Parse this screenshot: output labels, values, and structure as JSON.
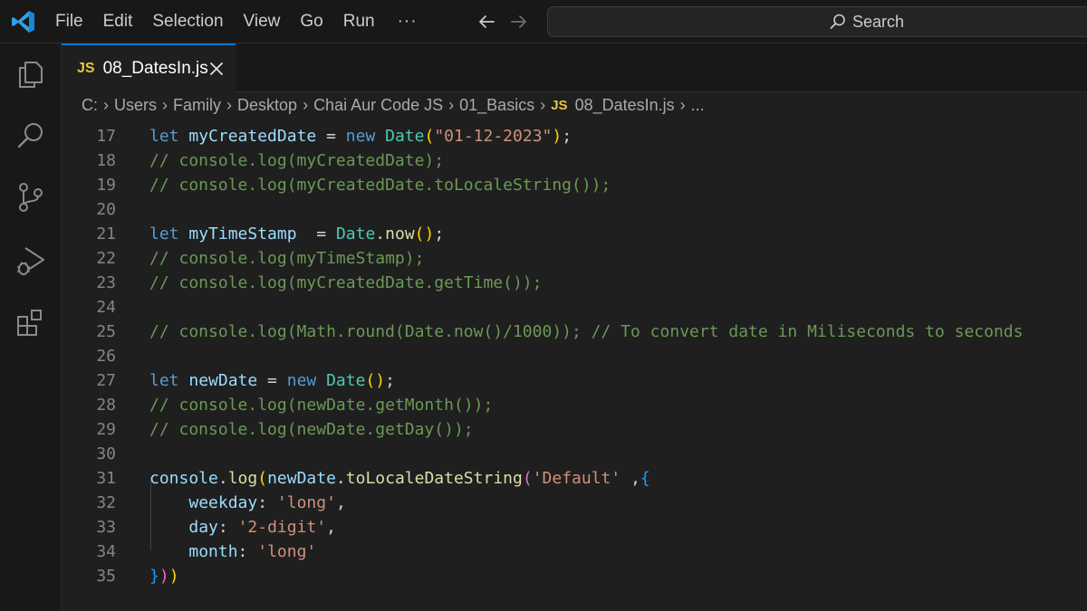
{
  "menu": {
    "items": [
      "File",
      "Edit",
      "Selection",
      "View",
      "Go",
      "Run"
    ],
    "more": "···"
  },
  "search": {
    "label": "Search"
  },
  "tab": {
    "badge": "JS",
    "label": "08_DatesIn.js"
  },
  "breadcrumb": {
    "parts": [
      "C:",
      "Users",
      "Family",
      "Desktop",
      "Chai Aur Code JS",
      "01_Basics"
    ],
    "file_badge": "JS",
    "file": "08_DatesIn.js",
    "more": "..."
  },
  "editor": {
    "lines": [
      {
        "n": "17",
        "tokens": [
          [
            "kw",
            "let "
          ],
          [
            "var",
            "myCreatedDate"
          ],
          [
            "pun",
            " = "
          ],
          [
            "kw",
            "new "
          ],
          [
            "cls",
            "Date"
          ],
          [
            "br1",
            "("
          ],
          [
            "str",
            "\"01-12-2023\""
          ],
          [
            "br1",
            ")"
          ],
          [
            "pun",
            ";"
          ]
        ]
      },
      {
        "n": "18",
        "tokens": [
          [
            "cmt",
            "// console.log(myCreatedDate);"
          ]
        ]
      },
      {
        "n": "19",
        "tokens": [
          [
            "cmt",
            "// console.log(myCreatedDate.toLocaleString());"
          ]
        ]
      },
      {
        "n": "20",
        "tokens": []
      },
      {
        "n": "21",
        "tokens": [
          [
            "kw",
            "let "
          ],
          [
            "var",
            "myTimeStamp"
          ],
          [
            "pun",
            "  = "
          ],
          [
            "cls",
            "Date"
          ],
          [
            "pun",
            "."
          ],
          [
            "fn",
            "now"
          ],
          [
            "br1",
            "()"
          ],
          [
            "pun",
            ";"
          ]
        ]
      },
      {
        "n": "22",
        "tokens": [
          [
            "cmt",
            "// console.log(myTimeStamp);"
          ]
        ]
      },
      {
        "n": "23",
        "tokens": [
          [
            "cmt",
            "// console.log(myCreatedDate.getTime());"
          ]
        ]
      },
      {
        "n": "24",
        "tokens": []
      },
      {
        "n": "25",
        "tokens": [
          [
            "cmt",
            "// console.log(Math.round(Date.now()/1000)); // To convert date in Miliseconds to seconds"
          ]
        ]
      },
      {
        "n": "26",
        "tokens": []
      },
      {
        "n": "27",
        "tokens": [
          [
            "kw",
            "let "
          ],
          [
            "var",
            "newDate"
          ],
          [
            "pun",
            " = "
          ],
          [
            "kw",
            "new "
          ],
          [
            "cls",
            "Date"
          ],
          [
            "br1",
            "()"
          ],
          [
            "pun",
            ";"
          ]
        ]
      },
      {
        "n": "28",
        "tokens": [
          [
            "cmt",
            "// console.log(newDate.getMonth());"
          ]
        ]
      },
      {
        "n": "29",
        "tokens": [
          [
            "cmt",
            "// console.log(newDate.getDay());"
          ]
        ]
      },
      {
        "n": "30",
        "tokens": []
      },
      {
        "n": "31",
        "tokens": [
          [
            "var",
            "console"
          ],
          [
            "pun",
            "."
          ],
          [
            "fn",
            "log"
          ],
          [
            "br1",
            "("
          ],
          [
            "var",
            "newDate"
          ],
          [
            "pun",
            "."
          ],
          [
            "fn",
            "toLocaleDateString"
          ],
          [
            "br2",
            "("
          ],
          [
            "str",
            "'Default'"
          ],
          [
            "pun",
            " ,"
          ],
          [
            "br3",
            "{"
          ]
        ]
      },
      {
        "n": "32",
        "tokens": [
          [
            "pun",
            "    "
          ],
          [
            "var",
            "weekday"
          ],
          [
            "pun",
            ": "
          ],
          [
            "str",
            "'long'"
          ],
          [
            "pun",
            ","
          ]
        ]
      },
      {
        "n": "33",
        "tokens": [
          [
            "pun",
            "    "
          ],
          [
            "var",
            "day"
          ],
          [
            "pun",
            ": "
          ],
          [
            "str",
            "'2-digit'"
          ],
          [
            "pun",
            ","
          ]
        ]
      },
      {
        "n": "34",
        "tokens": [
          [
            "pun",
            "    "
          ],
          [
            "var",
            "month"
          ],
          [
            "pun",
            ": "
          ],
          [
            "str",
            "'long'"
          ]
        ]
      },
      {
        "n": "35",
        "tokens": [
          [
            "br3",
            "}"
          ],
          [
            "br2",
            ")"
          ],
          [
            "br1",
            ")"
          ]
        ]
      }
    ]
  },
  "colors": {
    "accent": "#0078d4",
    "keyword": "#569cd6",
    "variable": "#9cdcfe",
    "class": "#4ec9b0",
    "function": "#dcdcaa",
    "string": "#ce9178",
    "comment": "#6a9955",
    "js_badge": "#e8c43c"
  },
  "icons": [
    "vscode-logo",
    "arrow-left-icon",
    "arrow-right-icon",
    "search-icon",
    "explorer-icon",
    "search-view-icon",
    "source-control-icon",
    "run-debug-icon",
    "extensions-icon",
    "close-icon"
  ]
}
